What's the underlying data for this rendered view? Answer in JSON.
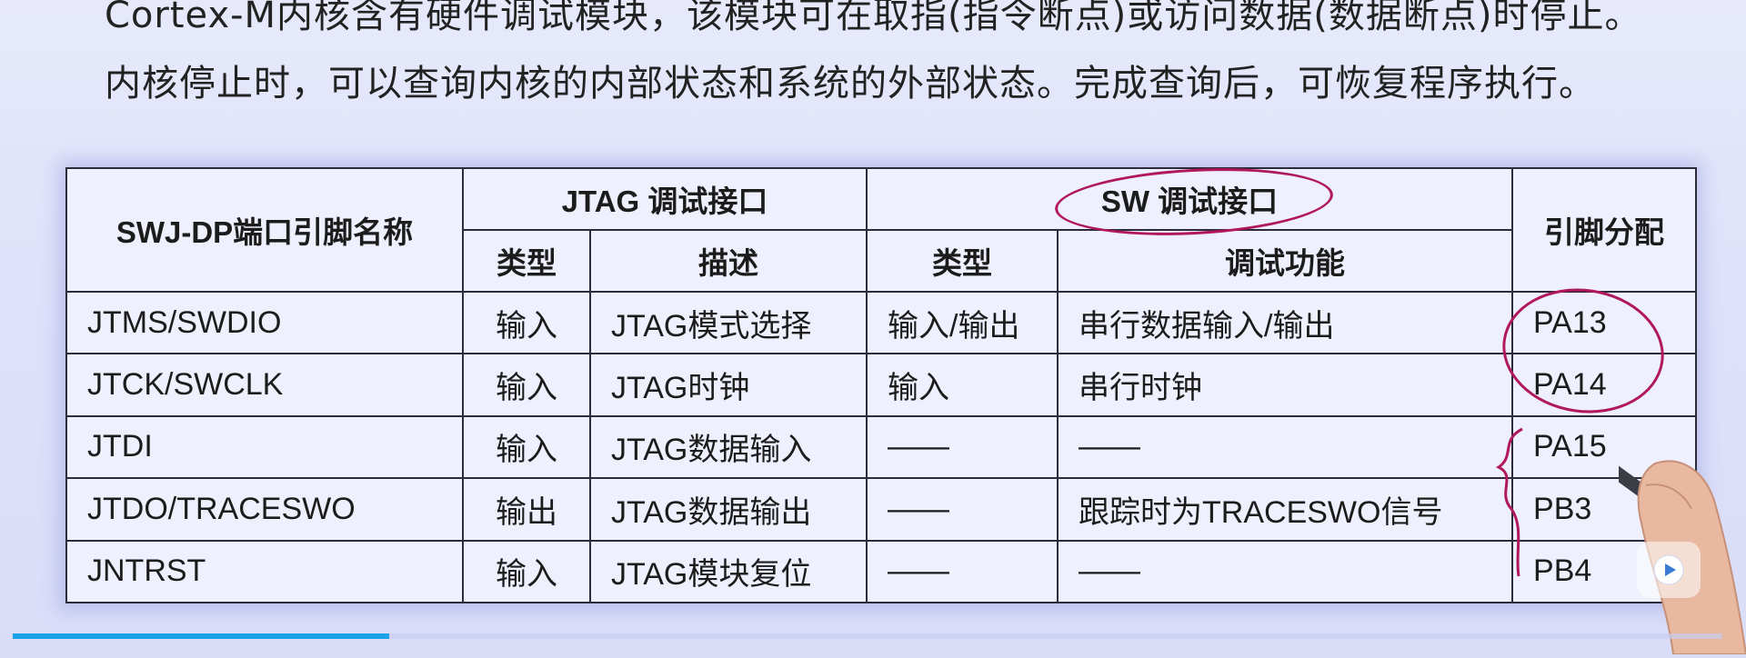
{
  "intro": {
    "line1": "Cortex-M内核含有硬件调试模块，该模块可在取指(指令断点)或访问数据(数据断点)时停止。",
    "line2": "内核停止时，可以查询内核的内部状态和系统的外部状态。完成查询后，可恢复程序执行。"
  },
  "table": {
    "header": {
      "port_name": "SWJ-DP端口引脚名称",
      "jtag": "JTAG 调试接口",
      "sw": "SW 调试接口",
      "pin": "引脚分配",
      "jtag_type": "类型",
      "jtag_desc": "描述",
      "sw_type": "类型",
      "sw_func": "调试功能"
    },
    "rows": [
      {
        "name": "JTMS/SWDIO",
        "jtag_type": "输入",
        "jtag_desc": "JTAG模式选择",
        "sw_type": "输入/输出",
        "sw_func": "串行数据输入/输出",
        "pin": "PA13"
      },
      {
        "name": "JTCK/SWCLK",
        "jtag_type": "输入",
        "jtag_desc": "JTAG时钟",
        "sw_type": "输入",
        "sw_func": "串行时钟",
        "pin": "PA14"
      },
      {
        "name": "JTDI",
        "jtag_type": "输入",
        "jtag_desc": "JTAG数据输入",
        "sw_type": "——",
        "sw_func": "——",
        "pin": "PA15"
      },
      {
        "name": "JTDO/TRACESWO",
        "jtag_type": "输出",
        "jtag_desc": "JTAG数据输出",
        "sw_type": "——",
        "sw_func": "跟踪时为TRACESWO信号",
        "pin": "PB3"
      },
      {
        "name": "JNTRST",
        "jtag_type": "输入",
        "jtag_desc": "JTAG模块复位",
        "sw_type": "——",
        "sw_func": "——",
        "pin": "PB4"
      }
    ]
  },
  "player": {
    "progress": 0.22,
    "play_icon": "play-icon",
    "accent": "#1aa3e8"
  },
  "annotation_color": "#b0185a"
}
